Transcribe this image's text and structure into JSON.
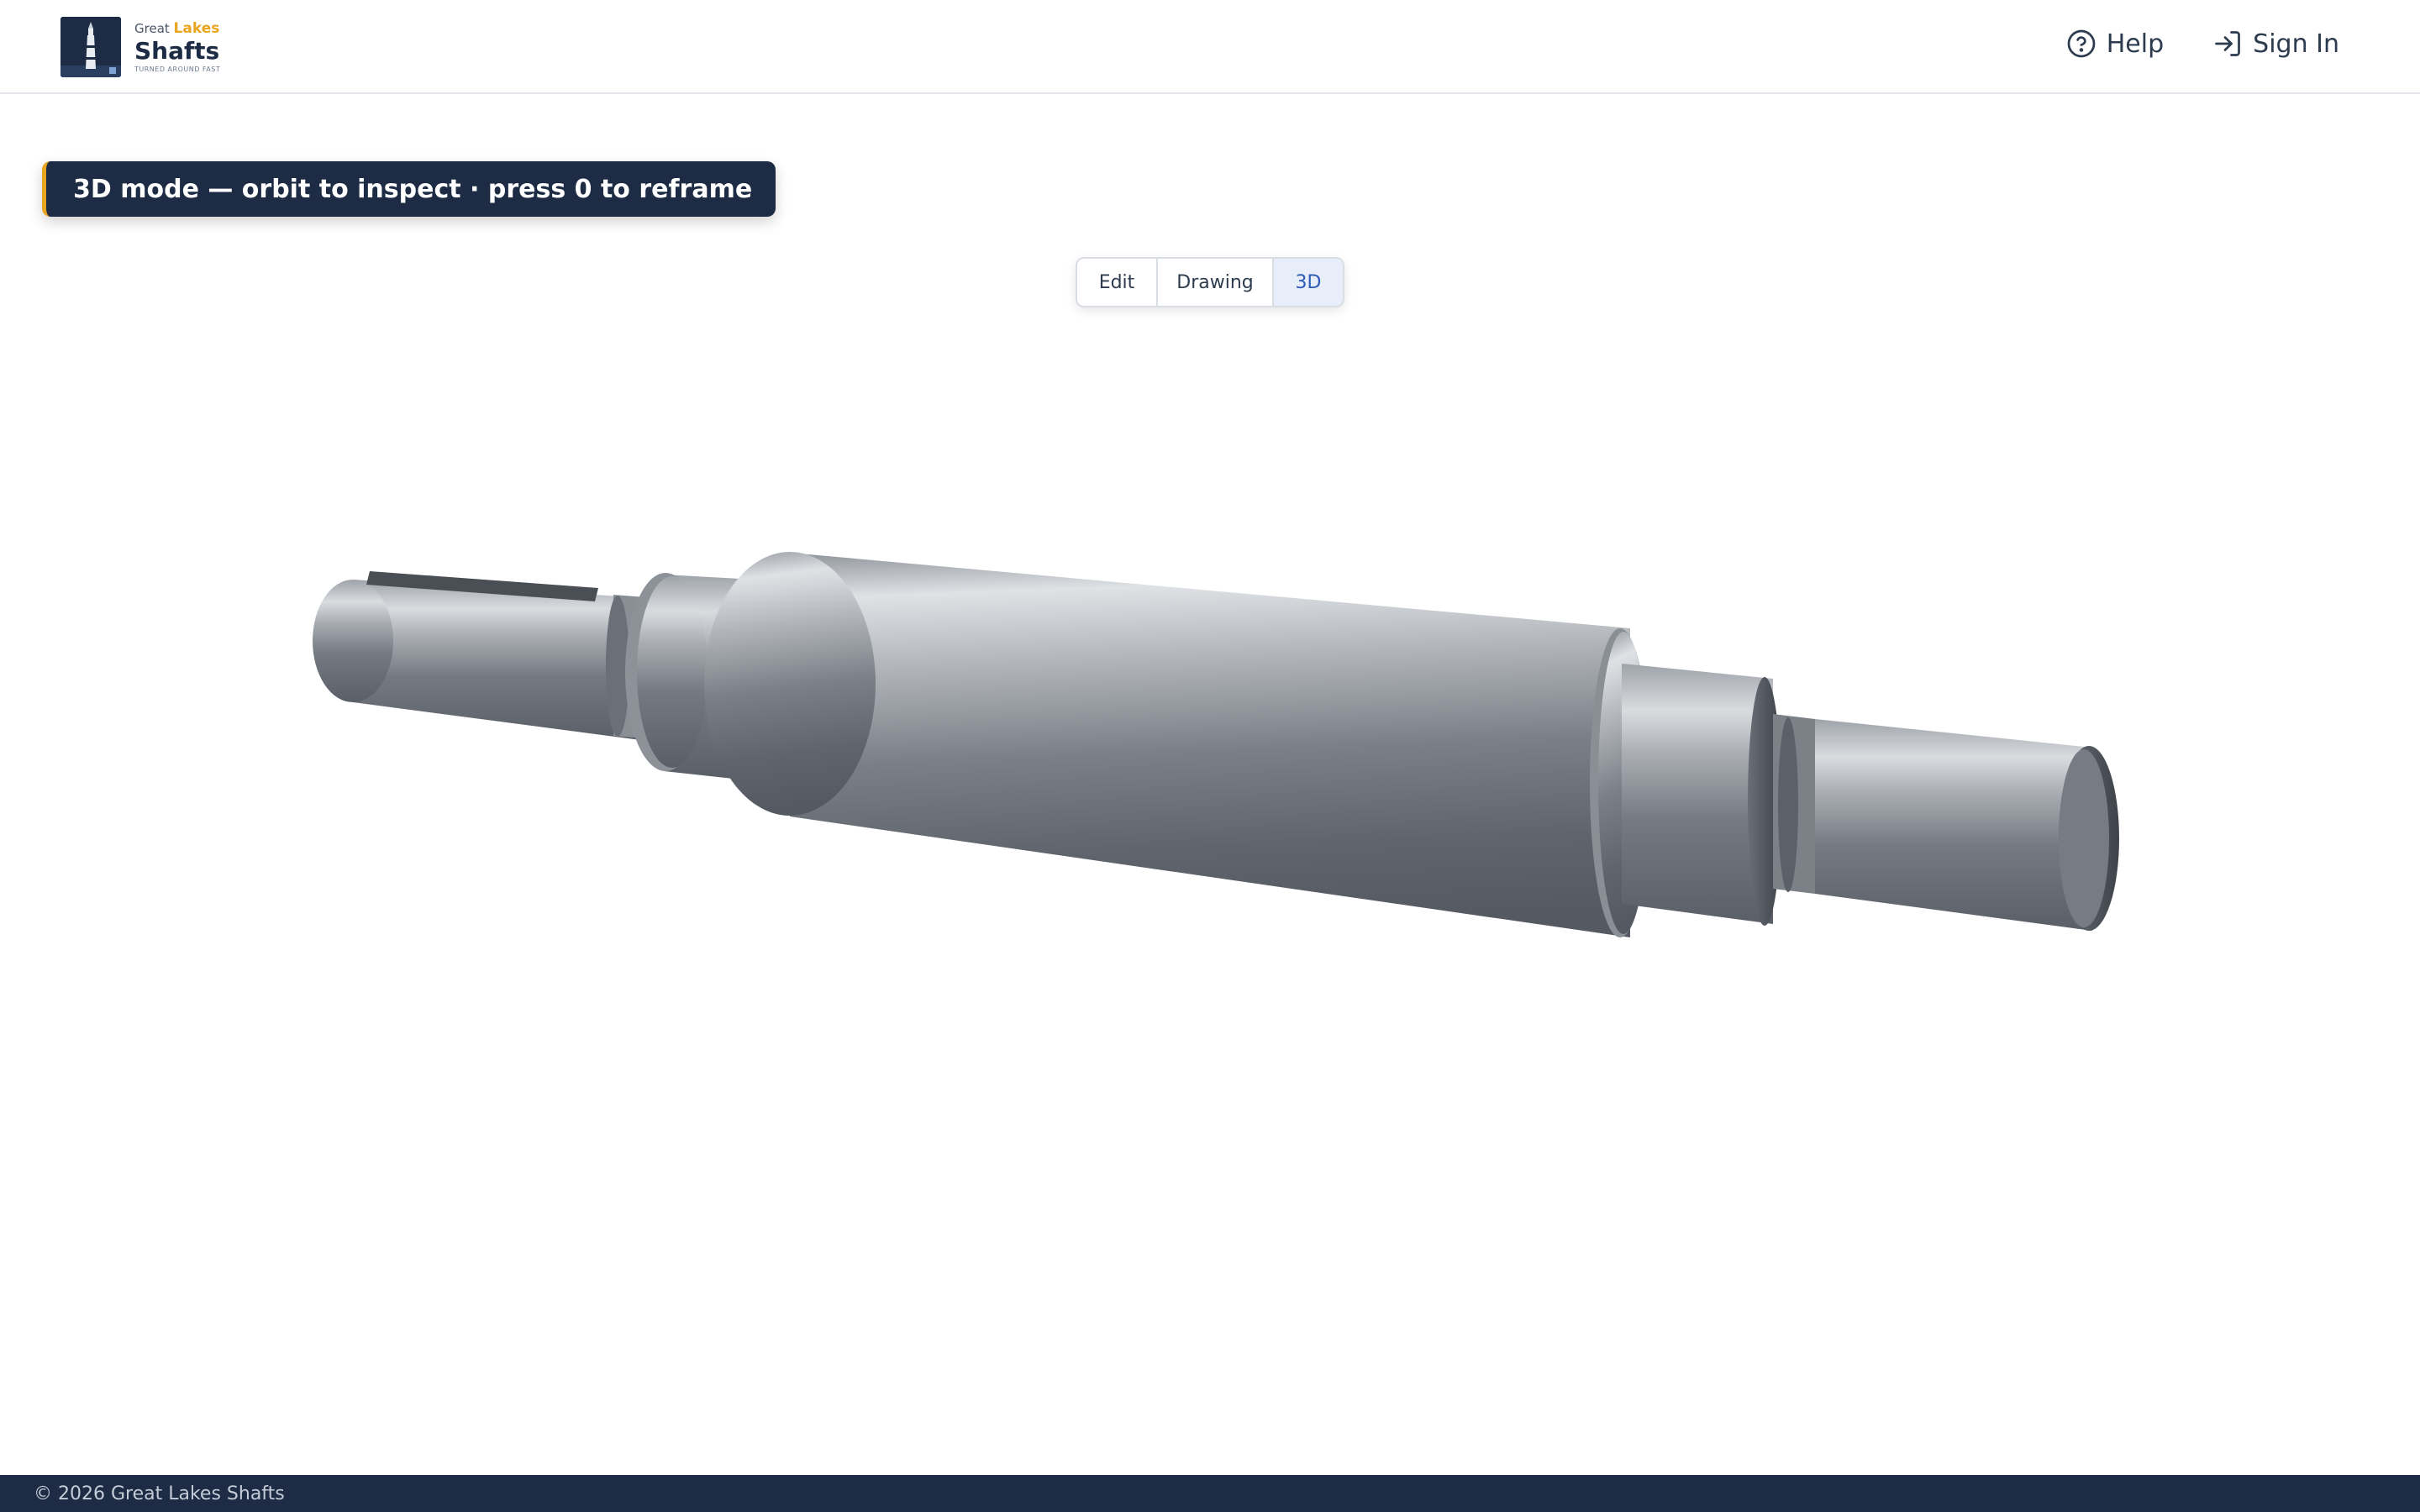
{
  "brand": {
    "top_word": "Great",
    "accent_word": "Lakes",
    "main_word": "Shafts",
    "tagline": "TURNED AROUND FAST"
  },
  "nav": {
    "help_label": "Help",
    "signin_label": "Sign In",
    "help_icon": "help-circle-icon",
    "signin_icon": "sign-in-icon"
  },
  "toast": {
    "message": "3D mode — orbit to inspect · press 0 to reframe"
  },
  "view_modes": {
    "items": [
      "Edit",
      "Drawing",
      "3D"
    ],
    "selected": "3D"
  },
  "footer": {
    "copyright": "© 2026 Great Lakes Shafts"
  },
  "colors": {
    "navy": "#1d2c44",
    "accent": "#e8a520",
    "active_tab_bg": "#e7eef9",
    "active_tab_text": "#2b5bb5"
  }
}
